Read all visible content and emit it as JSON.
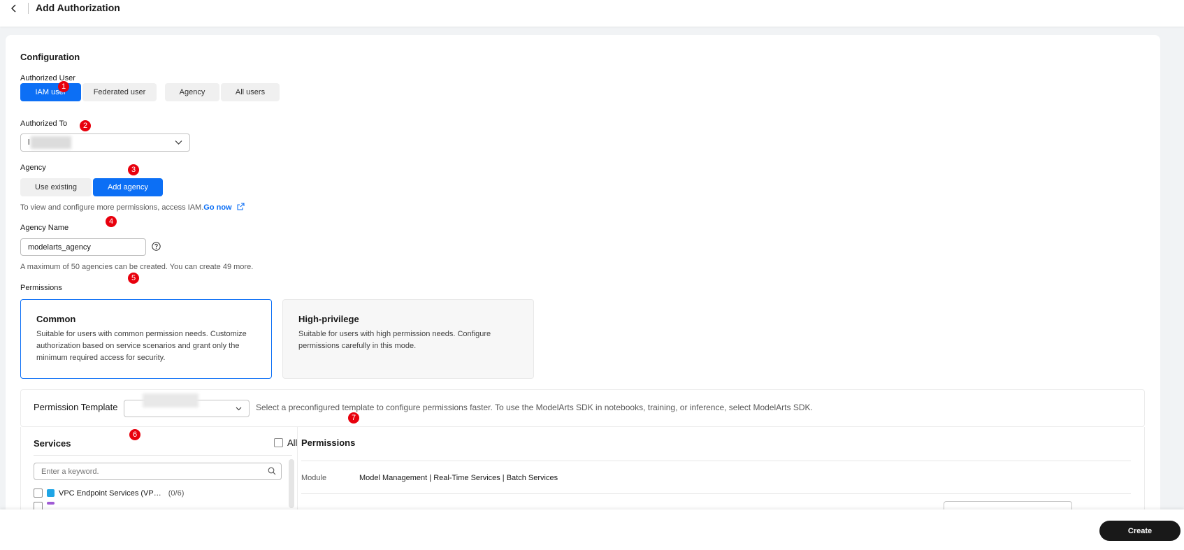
{
  "header": {
    "title": "Add Authorization"
  },
  "config": {
    "title": "Configuration",
    "authorized_user": {
      "label": "Authorized User",
      "options": [
        "IAM user",
        "Federated user",
        "Agency",
        "All users"
      ],
      "selected": "IAM user"
    },
    "authorized_to": {
      "label": "Authorized To",
      "value": "l"
    },
    "agency": {
      "label": "Agency",
      "options": [
        "Use existing",
        "Add agency"
      ],
      "selected": "Add agency",
      "hint_text": "To view and configure more permissions, access IAM.",
      "hint_link": "Go now"
    },
    "agency_name": {
      "label": "Agency Name",
      "value": "modelarts_agency",
      "hint": "A maximum of 50 agencies can be created. You can create 49 more."
    },
    "permissions": {
      "label": "Permissions",
      "cards": [
        {
          "title": "Common",
          "desc": "Suitable for users with common permission needs. Customize authorization based on service scenarios and grant only the minimum required access for security.",
          "selected": true
        },
        {
          "title": "High-privilege",
          "desc": "Suitable for users with high permission needs. Configure permissions carefully in this mode.",
          "selected": false
        }
      ]
    }
  },
  "template": {
    "label": "Permission Template",
    "desc": "Select a preconfigured template to configure permissions faster. To use the ModelArts SDK in notebooks, training, or inference, select ModelArts SDK."
  },
  "services": {
    "title": "Services",
    "all_label": "All",
    "search_placeholder": "Enter a keyword.",
    "items": [
      {
        "name": "VPC Endpoint Services (VP…",
        "count": "(0/6)",
        "icon_color": "#1ea5e6"
      },
      {
        "name": "",
        "count": "",
        "icon_color": "#a05bd5"
      }
    ]
  },
  "permissions_panel": {
    "title": "Permissions",
    "module_label": "Module",
    "module_value": "Model Management | Real-Time Services | Batch Services"
  },
  "footer": {
    "create_label": "Create"
  },
  "markers": [
    "1",
    "2",
    "3",
    "4",
    "5",
    "6",
    "7"
  ],
  "colors": {
    "accent": "#0c6ff5",
    "marker": "#e8000d",
    "primary_button": "#191919"
  }
}
